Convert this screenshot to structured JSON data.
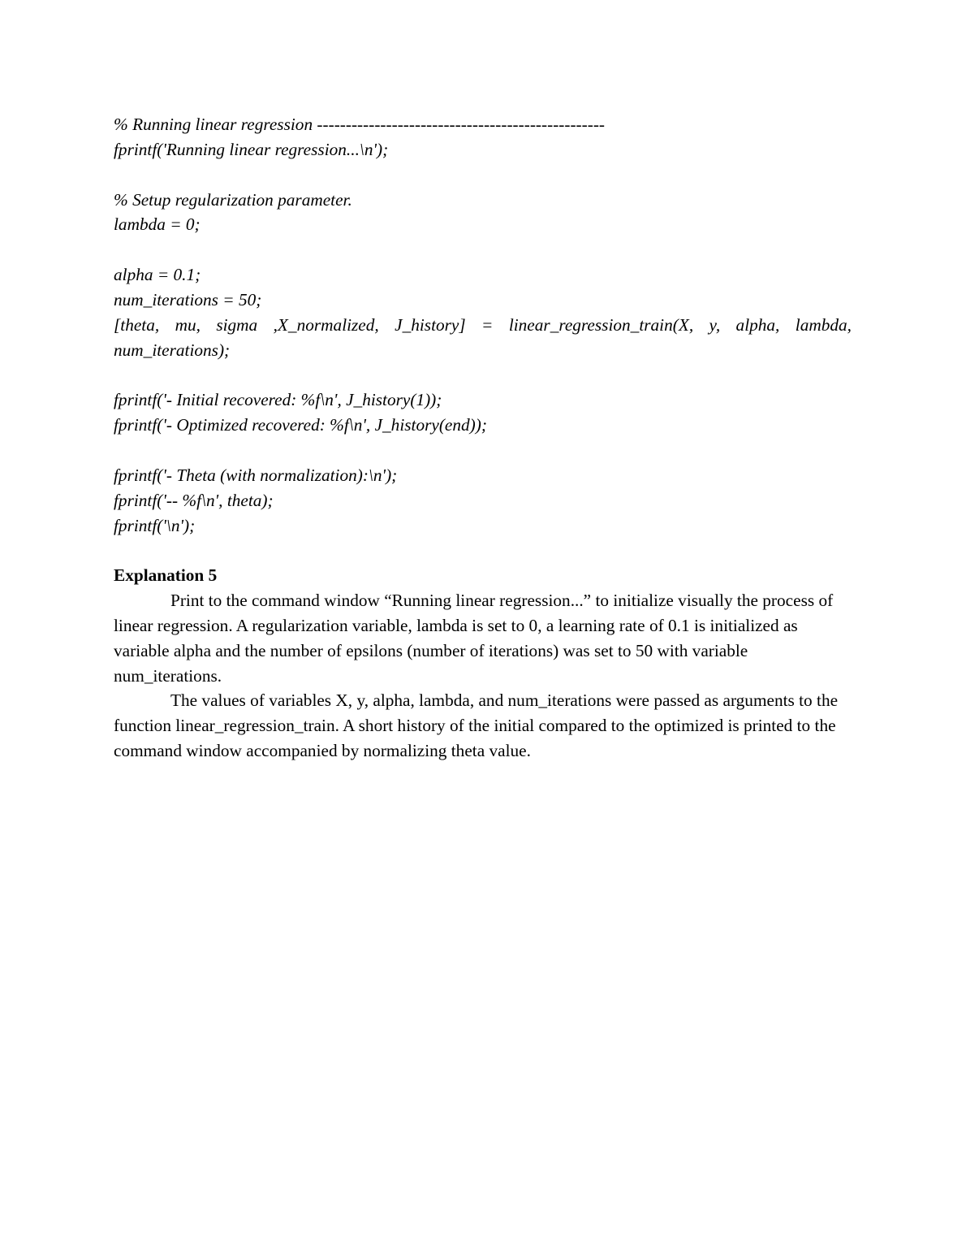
{
  "document": {
    "code_block_1": {
      "comment": "% Running linear regression --------------------------------------------------",
      "print_line": "fprintf('Running linear regression...\\n');"
    },
    "code_block_2": {
      "comment": "% Setup regularization parameter.",
      "lambda_line": "lambda = 0;"
    },
    "code_block_3": {
      "alpha_line": "alpha = 0.1;",
      "iterations_line": "num_iterations = 50;",
      "train_call_line_1": "[theta, mu, sigma ,X_normalized, J_history] = linear_regression_train(X, y, alpha, lambda,",
      "train_call_line_2": "num_iterations);"
    },
    "code_block_4": {
      "initial_line": "fprintf('- Initial recovered: %f\\n', J_history(1));",
      "optimized_line": "fprintf('- Optimized recovered: %f\\n', J_history(end));"
    },
    "code_block_5": {
      "theta_header_line": "fprintf('- Theta (with normalization):\\n');",
      "theta_values_line": "fprintf('-- %f\\n', theta);",
      "newline_line": "fprintf('\\n');"
    },
    "explanation": {
      "heading": "Explanation 5",
      "paragraphs": [
        "Print to the command window “Running linear regression...” to initialize visually the process of linear regression. A regularization variable, lambda is set to 0, a learning rate of 0.1 is initialized as variable alpha and the number of epsilons (number of iterations) was set to 50 with variable num_iterations.",
        "The values of variables X, y, alpha, lambda, and num_iterations were passed as arguments to the function linear_regression_train. A short history of the initial compared to the optimized is printed to the command window accompanied by normalizing theta value."
      ]
    }
  }
}
